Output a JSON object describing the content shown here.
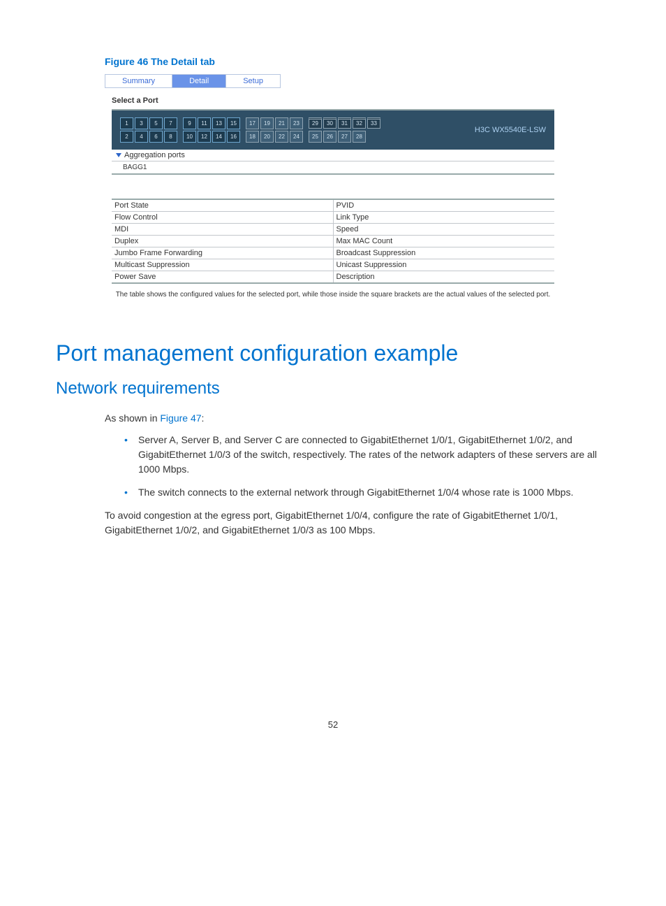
{
  "figure": {
    "title": "Figure 46 The Detail tab",
    "tabs": {
      "summary": "Summary",
      "detail": "Detail",
      "setup": "Setup"
    },
    "select_label": "Select a Port",
    "device_label": "H3C WX5540E-LSW",
    "ports_top": [
      "1",
      "3",
      "5",
      "7",
      "9",
      "11",
      "13",
      "15",
      "17",
      "19",
      "21",
      "23"
    ],
    "ports_bottom": [
      "2",
      "4",
      "6",
      "8",
      "10",
      "12",
      "14",
      "16",
      "18",
      "20",
      "22",
      "24"
    ],
    "ports_top2": [
      "29",
      "30",
      "31",
      "32",
      "33"
    ],
    "ports_bottom2": [
      "25",
      "26",
      "27",
      "28"
    ],
    "agg_header": "Aggregation ports",
    "agg_item": "BAGG1",
    "props_left": [
      "Port State",
      "Flow Control",
      "MDI",
      "Duplex",
      "Jumbo Frame Forwarding",
      "Multicast Suppression",
      "Power Save"
    ],
    "props_right": [
      "PVID",
      "Link Type",
      "Speed",
      "Max MAC Count",
      "Broadcast Suppression",
      "Unicast Suppression",
      "Description"
    ],
    "caption": "The table shows the configured values for the selected port, while those inside the square brackets are the actual values of the selected port."
  },
  "h1": "Port management configuration example",
  "h2": "Network requirements",
  "intro_prefix": "As shown in ",
  "intro_link": "Figure 47",
  "intro_suffix": ":",
  "bullets": [
    "Server A, Server B, and Server C are connected to GigabitEthernet 1/0/1, GigabitEthernet 1/0/2, and GigabitEthernet 1/0/3 of the switch, respectively. The rates of the network adapters of these servers are all 1000 Mbps.",
    "The switch connects to the external network through GigabitEthernet 1/0/4 whose rate is 1000 Mbps."
  ],
  "para2": "To avoid congestion at the egress port, GigabitEthernet 1/0/4, configure the rate of GigabitEthernet 1/0/1, GigabitEthernet 1/0/2, and GigabitEthernet 1/0/3 as 100 Mbps.",
  "page_num": "52"
}
